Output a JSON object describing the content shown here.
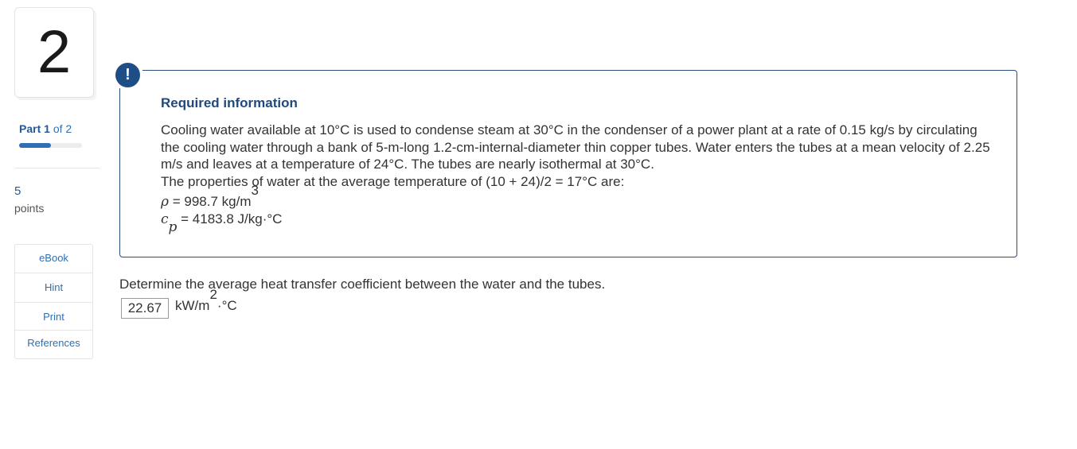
{
  "question": {
    "number": "2"
  },
  "part": {
    "prefix": "Part",
    "current": "1",
    "of_text": "of 2",
    "progress_fraction": 0.5
  },
  "points": {
    "value": "5",
    "label": "points"
  },
  "tools": [
    {
      "label": "eBook"
    },
    {
      "label": "Hint"
    },
    {
      "label": "Print"
    },
    {
      "label": "References"
    }
  ],
  "info": {
    "icon_glyph": "!",
    "title": "Required information",
    "paragraph": "Cooling water available at 10°C is used to condense steam at 30°C in the condenser of a power plant at a rate of 0.15 kg/s by circulating the cooling water through a bank of 5-m-long 1.2-cm-internal-diameter thin copper tubes. Water enters the tubes at a mean velocity of 2.25 m/s and leaves at a temperature of 24°C. The tubes are nearly isothermal at 30°C.",
    "properties_intro": "The properties of water at the average temperature of (10 + 24)/2 = 17°C are:",
    "rho": {
      "symbol": "ρ",
      "value": " = 998.7 kg/m",
      "exponent": "3"
    },
    "cp": {
      "symbol": "c",
      "subscript": "p",
      "value": " = 4183.8 J/kg·°C"
    }
  },
  "prompt": {
    "text": "Determine the average heat transfer coefficient between the water and the tubes.",
    "answer_value": "22.67",
    "unit_prefix": "kW/m",
    "unit_exponent": "2",
    "unit_suffix": "·°C"
  },
  "colors": {
    "accent": "#2f6fb3",
    "info_border": "#2a4d7a",
    "alert_icon": "#1f4e86"
  }
}
